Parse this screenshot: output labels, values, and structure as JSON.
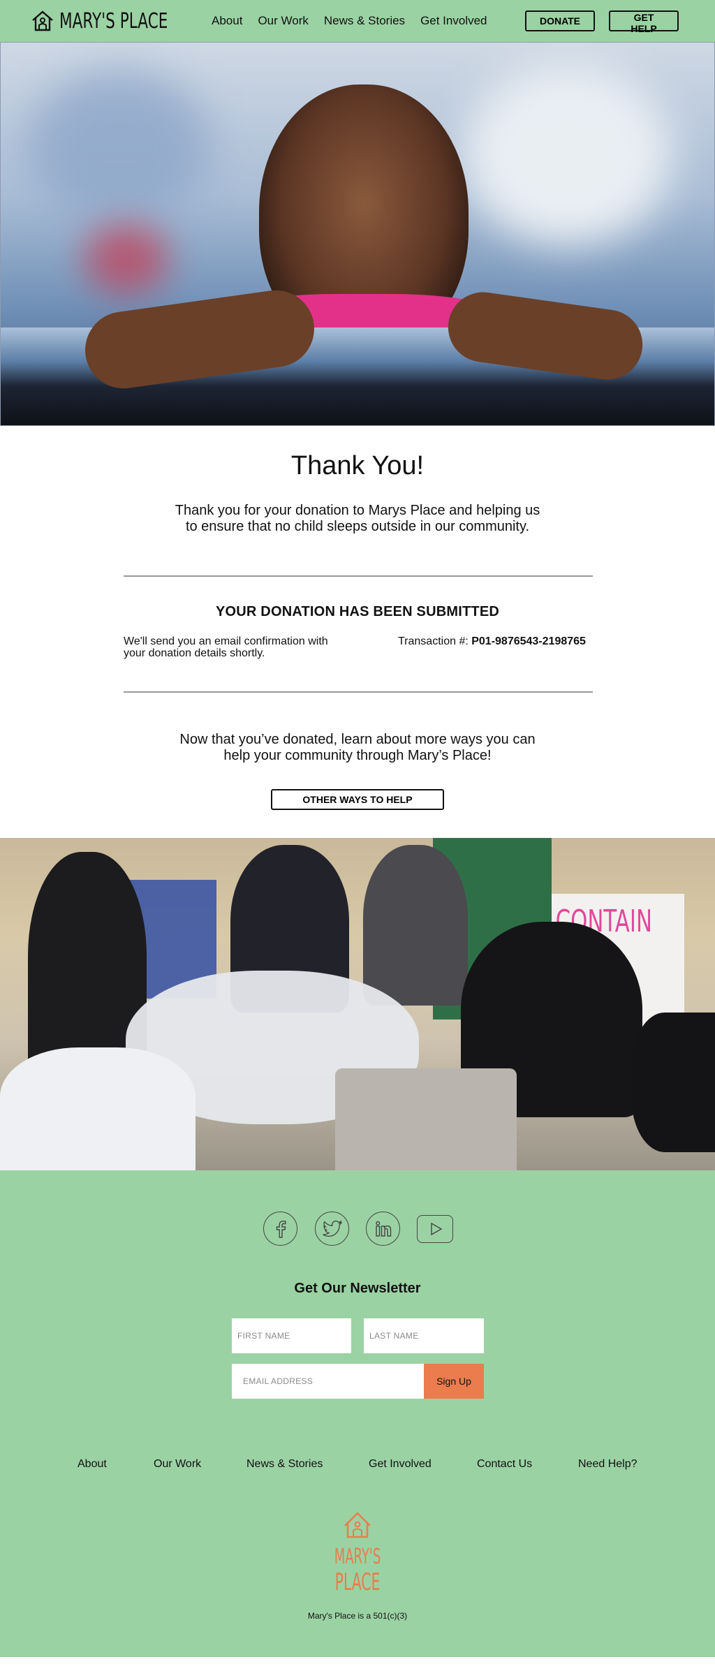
{
  "header": {
    "logo_text": "MARY'S PLACE",
    "nav": [
      "About",
      "Our Work",
      "News & Stories",
      "Get Involved"
    ],
    "donate_label": "DONATE",
    "help_label": "GET HELP"
  },
  "thanks": {
    "title": "Thank You!",
    "subtitle": "Thank you for your donation to Marys Place and helping us to ensure that no child sleeps outside in our community.",
    "submitted_heading": "YOUR DONATION HAS BEEN SUBMITTED",
    "email_note": "We'll send you an email confirmation with your donation details shortly.",
    "transaction_label": "Transaction #: ",
    "transaction_id": "P01-9876543-2198765",
    "learn_more": "Now that you’ve donated, learn about more ways you can help your community through Mary’s Place!",
    "other_ways_label": "OTHER WAYS TO HELP"
  },
  "photo2": {
    "sign_text": "CONTAIN"
  },
  "footer": {
    "social_icons": [
      "facebook-icon",
      "twitter-icon",
      "linkedin-icon",
      "youtube-icon"
    ],
    "newsletter_title": "Get Our Newsletter",
    "first_name_placeholder": "FIRST NAME",
    "last_name_placeholder": "LAST NAME",
    "email_placeholder": "EMAIL ADDRESS",
    "signup_label": "Sign Up",
    "nav": [
      "About",
      "Our Work",
      "News & Stories",
      "Get Involved",
      "Contact Us",
      "Need Help?"
    ],
    "logo_line1": "MARY'S",
    "logo_line2": "PLACE",
    "nonprofit_note": "Mary's Place is a 501(c)(3)"
  },
  "colors": {
    "brand_green": "#9bd2a3",
    "accent_orange": "#ea7c4e"
  }
}
